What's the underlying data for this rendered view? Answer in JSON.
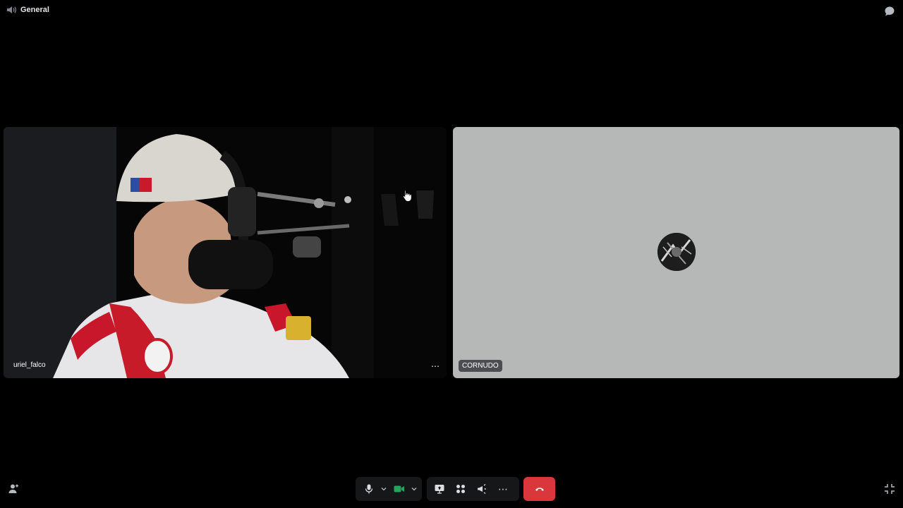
{
  "topbar": {
    "channel_name": "General",
    "channel_icon": "speaker-icon",
    "chat_icon": "chat-bubble-icon"
  },
  "participants": [
    {
      "name": "uriel_falco",
      "type": "video"
    },
    {
      "name": "CORNUDO",
      "type": "avatar"
    }
  ],
  "tile_more_label": "⋯",
  "controls": {
    "microphone_icon": "microphone-icon",
    "camera_icon": "camera-icon",
    "screen_share_icon": "screen-share-icon",
    "activities_icon": "activities-icon",
    "soundboard_icon": "soundboard-icon",
    "more_label": "⋯",
    "disconnect_icon": "phone-hangup-icon"
  },
  "colors": {
    "background": "#000000",
    "avatar_tile": "#b5b8b6",
    "hangup_red": "#da373c",
    "camera_on_green": "#23a55a",
    "control_bg": "#161719"
  }
}
